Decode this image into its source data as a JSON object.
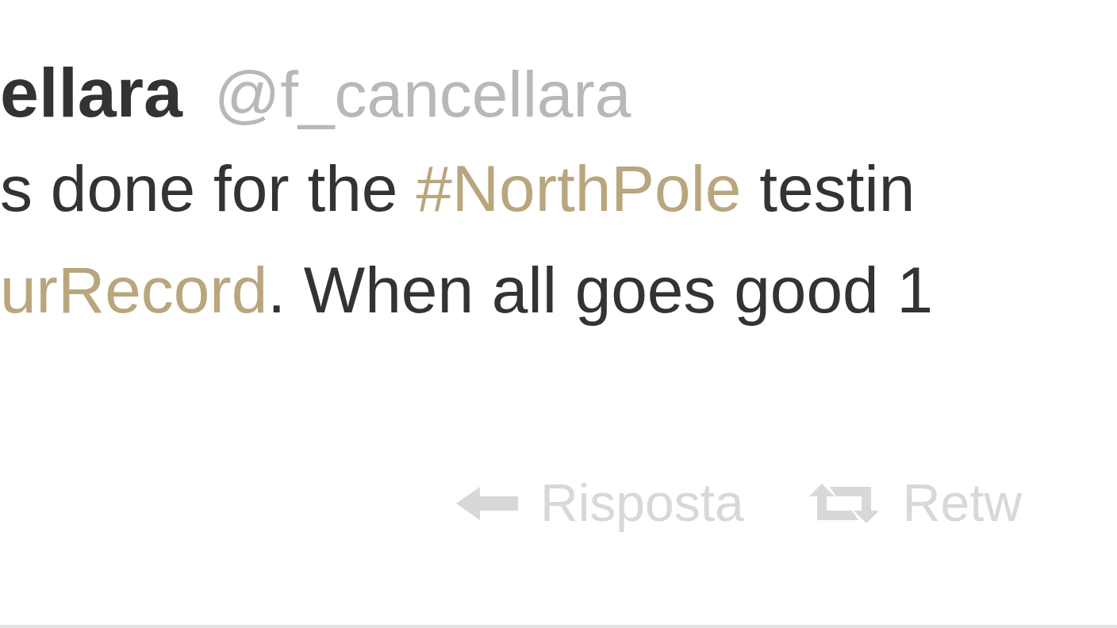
{
  "tweet": {
    "name": "ellara",
    "handle": "@f_cancellara",
    "lines": [
      [
        {
          "kind": "text",
          "text": "s done for the "
        },
        {
          "kind": "hashtag",
          "text": "#NorthPole"
        },
        {
          "kind": "text",
          "text": " testin"
        }
      ],
      [
        {
          "kind": "hashtag",
          "text": "urRecord"
        },
        {
          "kind": "text",
          "text": ". When all goes good 1"
        }
      ]
    ],
    "actions": [
      {
        "kind": "reply",
        "label": "Risposta"
      },
      {
        "kind": "retweet",
        "label": "Retw"
      }
    ]
  }
}
